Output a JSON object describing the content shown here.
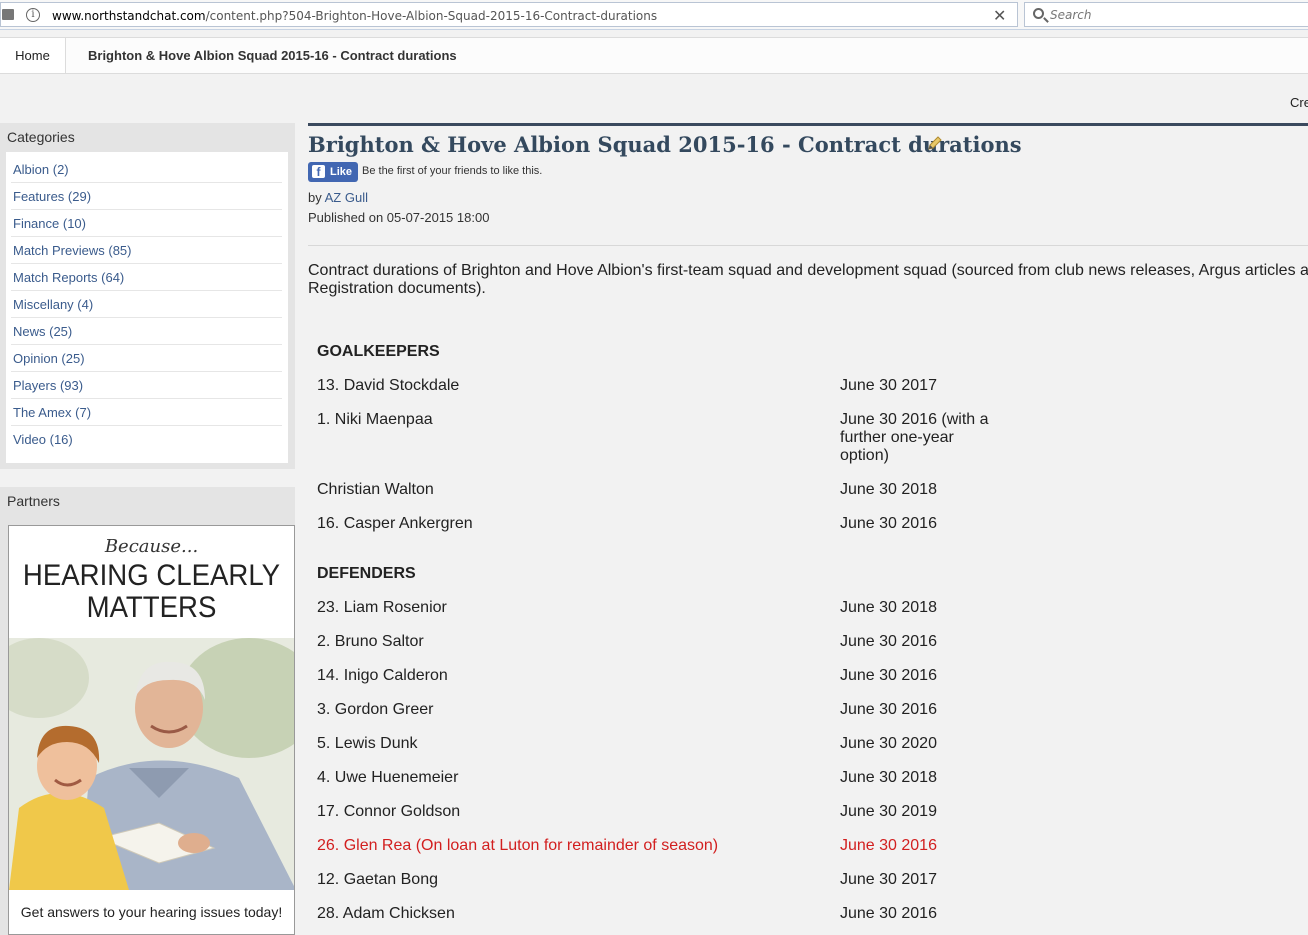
{
  "browser": {
    "url_domain": "www.northstandchat.com",
    "url_path": "/content.php?504-Brighton-Hove-Albion-Squad-2015-16-Contract-durations",
    "search_placeholder": "Search"
  },
  "breadcrumb": {
    "home": "Home",
    "current": "Brighton & Hove Albion Squad 2015-16 - Contract durations"
  },
  "header_right_link": "Cre",
  "sidebar": {
    "categories_title": "Categories",
    "categories": [
      {
        "label": "Albion (2)"
      },
      {
        "label": "Features (29)"
      },
      {
        "label": "Finance (10)"
      },
      {
        "label": "Match Previews (85)"
      },
      {
        "label": "Match Reports (64)"
      },
      {
        "label": "Miscellany (4)"
      },
      {
        "label": "News (25)"
      },
      {
        "label": "Opinion (25)"
      },
      {
        "label": "Players (93)"
      },
      {
        "label": "The Amex (7)"
      },
      {
        "label": "Video (16)"
      }
    ],
    "partners_title": "Partners",
    "ad": {
      "because": "Because...",
      "headline_line1": "HEARING CLEARLY",
      "headline_line2": "MATTERS",
      "tagline": "Get answers to your hearing issues today!"
    }
  },
  "article": {
    "title": "Brighton & Hove Albion Squad 2015-16 - Contract durations",
    "fb_like_label": "Like",
    "fb_like_text": "Be the first of your friends to like this.",
    "by_prefix": "by",
    "author": "AZ Gull",
    "published": "Published on 05-07-2015 18:00",
    "intro": "Contract durations of Brighton and Hove Albion's first-team squad and development squad (sourced from club news releases, Argus articles a Registration documents).",
    "sections": {
      "goalkeepers": {
        "heading": "GOALKEEPERS",
        "players": [
          {
            "name": "13. David Stockdale",
            "contract": "June 30 2017"
          },
          {
            "name": "1. Niki Maenpaa",
            "contract": "June 30 2016 (with a further one-year option)"
          },
          {
            "name": "Christian Walton",
            "contract": "June 30 2018"
          },
          {
            "name": "16. Casper Ankergren",
            "contract": "June 30 2016"
          }
        ]
      },
      "defenders": {
        "heading": "DEFENDERS",
        "players": [
          {
            "name": "23. Liam Rosenior",
            "contract": "June 30 2018"
          },
          {
            "name": "2. Bruno Saltor",
            "contract": "June 30 2016"
          },
          {
            "name": "14. Inigo Calderon",
            "contract": "June 30 2016"
          },
          {
            "name": "3. Gordon Greer",
            "contract": "June 30 2016"
          },
          {
            "name": "5. Lewis Dunk",
            "contract": "June 30 2020"
          },
          {
            "name": "4. Uwe Huenemeier",
            "contract": "June 30 2018"
          },
          {
            "name": "17. Connor Goldson",
            "contract": "June 30 2019"
          },
          {
            "name": "26. Glen Rea (On loan at Luton for remainder of season)",
            "contract": "June 30 2016",
            "highlight": true
          },
          {
            "name": "12. Gaetan Bong",
            "contract": "June 30 2017"
          },
          {
            "name": "28. Adam Chicksen",
            "contract": "June 30 2016"
          }
        ]
      }
    }
  },
  "colors": {
    "link": "#3a5b8c",
    "title": "#34495e",
    "highlight": "#d21f1f",
    "facebook": "#4267b2"
  }
}
